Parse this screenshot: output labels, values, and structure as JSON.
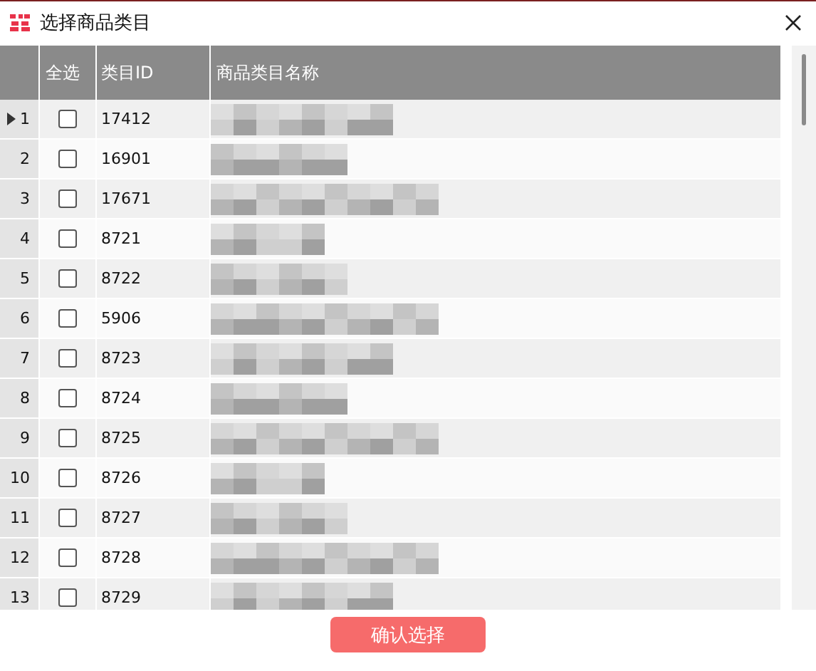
{
  "window": {
    "title": "选择商品类目"
  },
  "table": {
    "columns": [
      "全选",
      "类目ID",
      "商品类目名称"
    ],
    "rows": [
      {
        "number": "1",
        "selected": true,
        "checked": false,
        "id": "17412"
      },
      {
        "number": "2",
        "selected": false,
        "checked": false,
        "id": "16901"
      },
      {
        "number": "3",
        "selected": false,
        "checked": false,
        "id": "17671"
      },
      {
        "number": "4",
        "selected": false,
        "checked": false,
        "id": "8721"
      },
      {
        "number": "5",
        "selected": false,
        "checked": false,
        "id": "8722"
      },
      {
        "number": "6",
        "selected": false,
        "checked": false,
        "id": "5906"
      },
      {
        "number": "7",
        "selected": false,
        "checked": false,
        "id": "8723"
      },
      {
        "number": "8",
        "selected": false,
        "checked": false,
        "id": "8724"
      },
      {
        "number": "9",
        "selected": false,
        "checked": false,
        "id": "8725"
      },
      {
        "number": "10",
        "selected": false,
        "checked": false,
        "id": "8726"
      },
      {
        "number": "11",
        "selected": false,
        "checked": false,
        "id": "8727"
      },
      {
        "number": "12",
        "selected": false,
        "checked": false,
        "id": "8728"
      },
      {
        "number": "13",
        "selected": false,
        "checked": false,
        "id": "8729"
      }
    ]
  },
  "buttons": [
    "确认选择"
  ]
}
